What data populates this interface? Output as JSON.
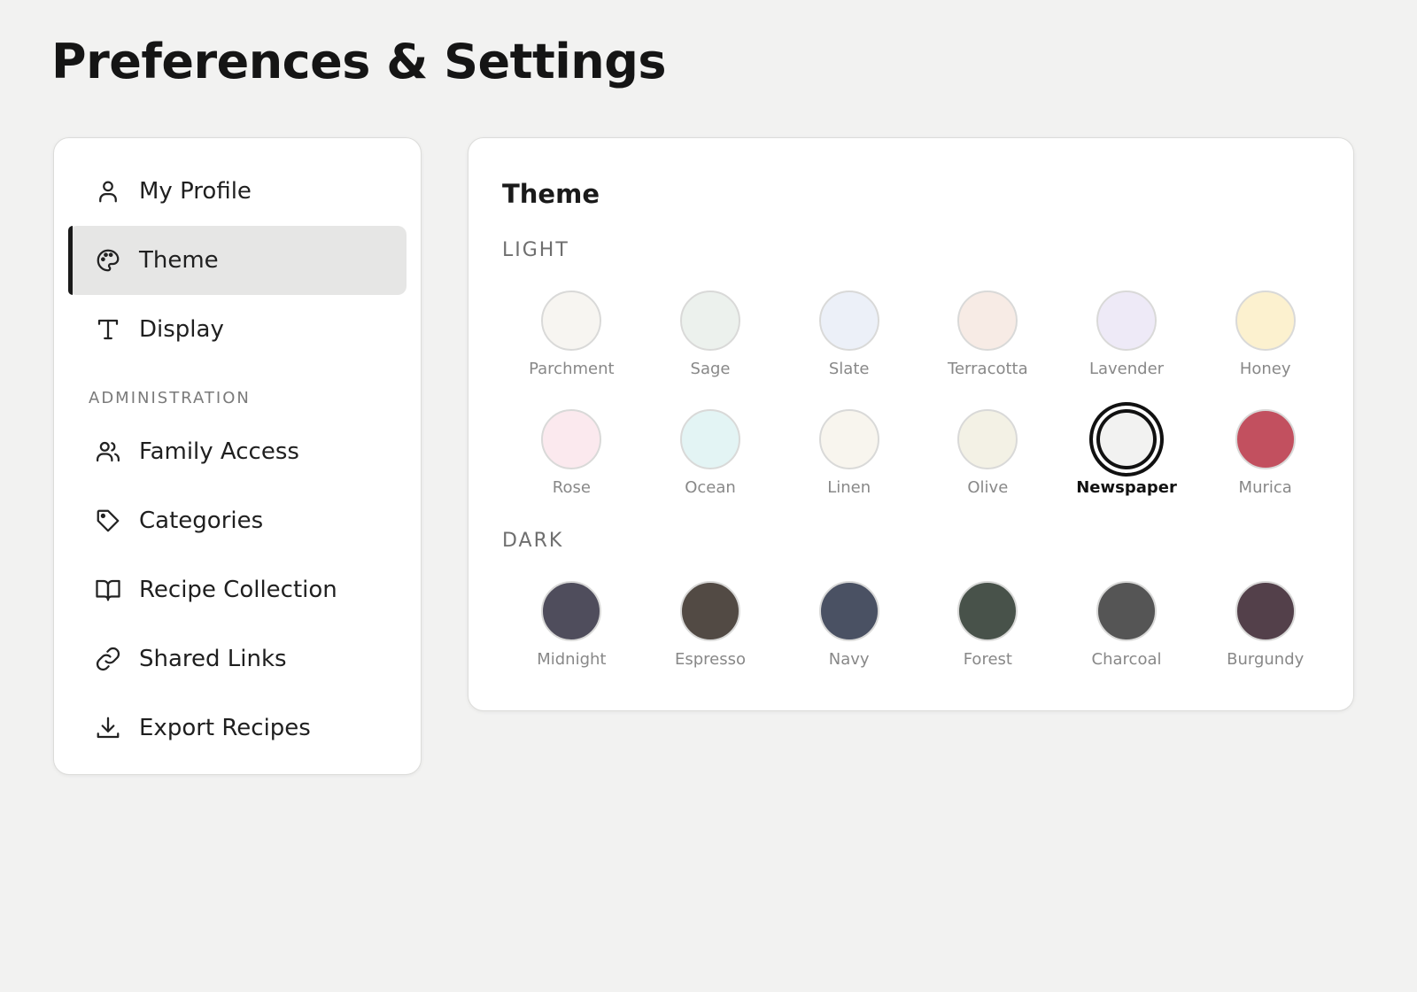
{
  "page": {
    "title": "Preferences & Settings"
  },
  "sidebar": {
    "items": [
      {
        "label": "My Profile",
        "icon": "user-icon"
      },
      {
        "label": "Theme",
        "icon": "palette-icon",
        "active": true
      },
      {
        "label": "Display",
        "icon": "text-icon"
      }
    ],
    "admin_label": "ADMINISTRATION",
    "admin_items": [
      {
        "label": "Family Access",
        "icon": "users-icon"
      },
      {
        "label": "Categories",
        "icon": "tag-icon"
      },
      {
        "label": "Recipe Collection",
        "icon": "book-icon"
      },
      {
        "label": "Shared Links",
        "icon": "link-icon"
      },
      {
        "label": "Export Recipes",
        "icon": "download-icon"
      }
    ]
  },
  "theme": {
    "title": "Theme",
    "light_label": "LIGHT",
    "dark_label": "DARK",
    "selected": "Newspaper",
    "light_row1": [
      {
        "name": "Parchment",
        "color": "#f7f5f1"
      },
      {
        "name": "Sage",
        "color": "#ecf1ed"
      },
      {
        "name": "Slate",
        "color": "#ecf0f8"
      },
      {
        "name": "Terracotta",
        "color": "#f7ebe5"
      },
      {
        "name": "Lavender",
        "color": "#eeeaf7"
      },
      {
        "name": "Honey",
        "color": "#fcf1cf"
      }
    ],
    "light_row2": [
      {
        "name": "Rose",
        "color": "#fbe9ee"
      },
      {
        "name": "Ocean",
        "color": "#e3f4f4"
      },
      {
        "name": "Linen",
        "color": "#f8f5ee"
      },
      {
        "name": "Olive",
        "color": "#f3f1e5"
      },
      {
        "name": "Newspaper",
        "color": "#f2f2f1"
      },
      {
        "name": "Murica",
        "color": "#c2505f"
      }
    ],
    "dark_row": [
      {
        "name": "Midnight",
        "color": "#4f4d5c"
      },
      {
        "name": "Espresso",
        "color": "#524a44"
      },
      {
        "name": "Navy",
        "color": "#4a5163"
      },
      {
        "name": "Forest",
        "color": "#48524a"
      },
      {
        "name": "Charcoal",
        "color": "#555555"
      },
      {
        "name": "Burgundy",
        "color": "#53404a"
      }
    ]
  }
}
